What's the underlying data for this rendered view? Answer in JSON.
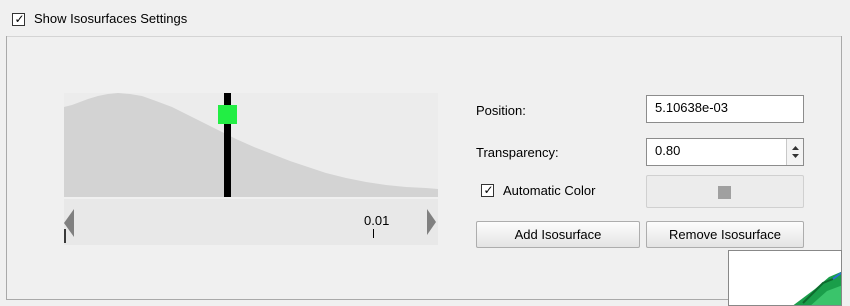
{
  "header": {
    "show_isosurfaces_label": "Show Isosurfaces Settings",
    "show_isosurfaces_checked": true
  },
  "histogram": {
    "range_value_label": "0.01",
    "marker_color": "#22ee44",
    "isovalue_fraction": 0.44
  },
  "form": {
    "position_label": "Position:",
    "position_value": "5.10638e-03",
    "transparency_label": "Transparency:",
    "transparency_value": "0.80",
    "automatic_color_label": "Automatic Color",
    "automatic_color_checked": true
  },
  "buttons": {
    "add_isosurface": "Add Isosurface",
    "remove_isosurface": "Remove Isosurface"
  },
  "colors": {
    "histogram_fill": "#d3d3d3",
    "preview_swatch": "#a0a0a0"
  }
}
